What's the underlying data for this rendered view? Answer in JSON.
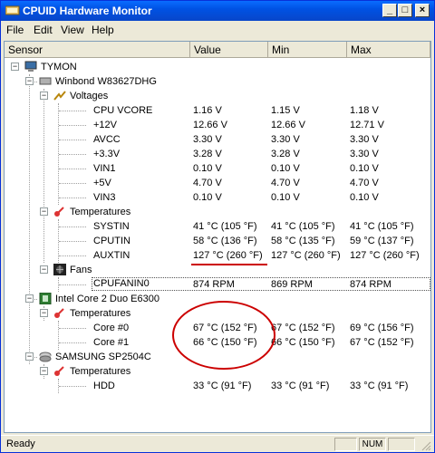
{
  "window": {
    "title": "CPUID Hardware Monitor",
    "buttons": [
      "_",
      "□",
      "×"
    ]
  },
  "menu": [
    {
      "label": "File"
    },
    {
      "label": "Edit"
    },
    {
      "label": "View"
    },
    {
      "label": "Help"
    }
  ],
  "columns": [
    "Sensor",
    "Value",
    "Min",
    "Max"
  ],
  "tree": {
    "computer": "TYMON",
    "chip1": {
      "name": "Winbond W83627DHG",
      "voltages_label": "Voltages",
      "voltages": [
        {
          "name": "CPU VCORE",
          "value": "1.16 V",
          "min": "1.15 V",
          "max": "1.18 V"
        },
        {
          "name": "+12V",
          "value": "12.66 V",
          "min": "12.66 V",
          "max": "12.71 V"
        },
        {
          "name": "AVCC",
          "value": "3.30 V",
          "min": "3.30 V",
          "max": "3.30 V"
        },
        {
          "name": "+3.3V",
          "value": "3.28 V",
          "min": "3.28 V",
          "max": "3.30 V"
        },
        {
          "name": "VIN1",
          "value": "0.10 V",
          "min": "0.10 V",
          "max": "0.10 V"
        },
        {
          "name": "+5V",
          "value": "4.70 V",
          "min": "4.70 V",
          "max": "4.70 V"
        },
        {
          "name": "VIN3",
          "value": "0.10 V",
          "min": "0.10 V",
          "max": "0.10 V"
        }
      ],
      "temps_label": "Temperatures",
      "temps": [
        {
          "name": "SYSTIN",
          "value": "41 °C (105 °F)",
          "min": "41 °C (105 °F)",
          "max": "41 °C (105 °F)"
        },
        {
          "name": "CPUTIN",
          "value": "58 °C (136 °F)",
          "min": "58 °C (135 °F)",
          "max": "59 °C (137 °F)"
        },
        {
          "name": "AUXTIN",
          "value": "127 °C (260 °F)",
          "min": "127 °C (260 °F)",
          "max": "127 °C (260 °F)"
        }
      ],
      "fans_label": "Fans",
      "fans": [
        {
          "name": "CPUFANIN0",
          "value": "874 RPM",
          "min": "869 RPM",
          "max": "874 RPM"
        }
      ]
    },
    "cpu": {
      "name": "Intel Core 2 Duo E6300",
      "temps_label": "Temperatures",
      "temps": [
        {
          "name": "Core #0",
          "value": "67 °C (152 °F)",
          "min": "67 °C (152 °F)",
          "max": "69 °C (156 °F)"
        },
        {
          "name": "Core #1",
          "value": "66 °C (150 °F)",
          "min": "66 °C (150 °F)",
          "max": "67 °C (152 °F)"
        }
      ]
    },
    "disk": {
      "name": "SAMSUNG SP2504C",
      "temps_label": "Temperatures",
      "temps": [
        {
          "name": "HDD",
          "value": "33 °C (91 °F)",
          "min": "33 °C (91 °F)",
          "max": "33 °C (91 °F)"
        }
      ]
    }
  },
  "status": {
    "text": "Ready",
    "num": "NUM"
  },
  "colors": {
    "titlebar": "#0052e4",
    "annotation": "#cc0000"
  }
}
